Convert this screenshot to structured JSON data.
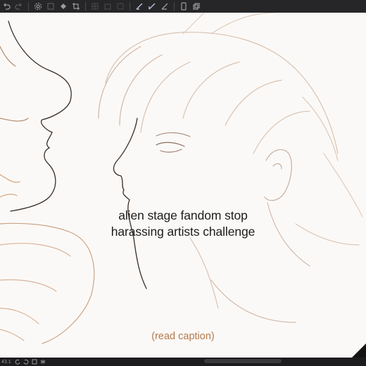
{
  "toolbar": {
    "tools": [
      {
        "icon": "undo-icon"
      },
      {
        "icon": "redo-icon"
      },
      {
        "icon": "settings-icon"
      },
      {
        "icon": "transform-icon"
      },
      {
        "icon": "fill-icon"
      },
      {
        "icon": "crop-icon"
      },
      {
        "icon": "grid-icon"
      },
      {
        "icon": "layer-icon"
      },
      {
        "icon": "frame-icon"
      },
      {
        "icon": "pen-icon"
      },
      {
        "icon": "pen-active-icon"
      },
      {
        "icon": "pen-pressure-icon"
      },
      {
        "icon": "device-icon"
      },
      {
        "icon": "copy-icon"
      }
    ]
  },
  "canvas": {
    "caption_line1": "alien stage fandom stop",
    "caption_line2": "harassing artists challenge",
    "note": "(read caption)"
  },
  "status": {
    "zoom": "43.1"
  },
  "colors": {
    "toolbar_bg": "#262628",
    "canvas_bg": "#fbf9f7",
    "sketch_line": "#c89a72",
    "note_text": "#b27a4e"
  }
}
